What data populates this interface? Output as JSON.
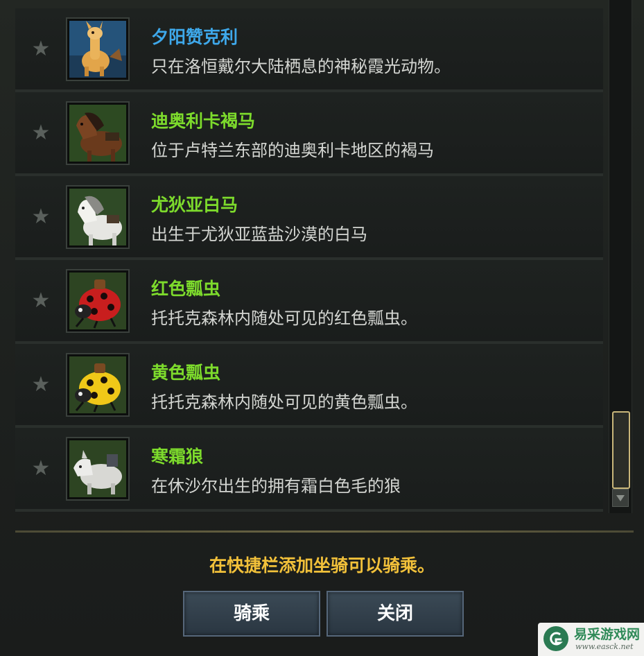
{
  "mounts": [
    {
      "name": "夕阳赞克利",
      "desc": "只在洛恒戴尔大陆栖息的神秘霞光动物。",
      "name_color": "#3ea8ea",
      "icon": "alpaca-icon"
    },
    {
      "name": "迪奥利卡褐马",
      "desc": "位于卢特兰东部的迪奥利卡地区的褐马",
      "name_color": "#7ddb2c",
      "icon": "brown-horse-icon"
    },
    {
      "name": "尤狄亚白马",
      "desc": "出生于尤狄亚蓝盐沙漠的白马",
      "name_color": "#7ddb2c",
      "icon": "white-horse-icon"
    },
    {
      "name": "红色瓢虫",
      "desc": "托托克森林内随处可见的红色瓢虫。",
      "name_color": "#7ddb2c",
      "icon": "red-ladybug-icon"
    },
    {
      "name": "黄色瓢虫",
      "desc": "托托克森林内随处可见的黄色瓢虫。",
      "name_color": "#7ddb2c",
      "icon": "yellow-ladybug-icon"
    },
    {
      "name": "寒霜狼",
      "desc": "在休沙尔出生的拥有霜白色毛的狼",
      "name_color": "#7ddb2c",
      "icon": "frost-wolf-icon"
    }
  ],
  "favorite_icon": "star-icon",
  "footer": {
    "hint": "在快捷栏添加坐骑可以骑乘。",
    "ride_label": "骑乘",
    "close_label": "关闭"
  },
  "watermark": {
    "big": "易采游戏网",
    "small": "www.easck.net"
  }
}
